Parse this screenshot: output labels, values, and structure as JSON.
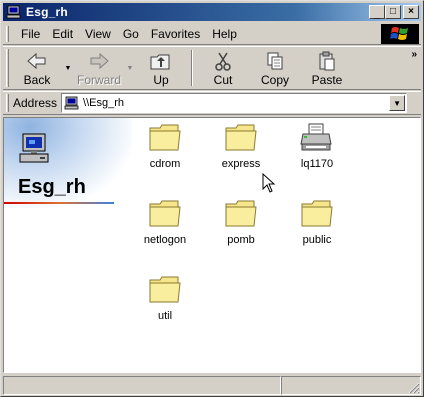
{
  "window": {
    "title": "Esg_rh",
    "controls": {
      "minimize": "_",
      "maximize": "□",
      "close": "×"
    }
  },
  "menu": [
    {
      "label": "File"
    },
    {
      "label": "Edit"
    },
    {
      "label": "View"
    },
    {
      "label": "Go"
    },
    {
      "label": "Favorites"
    },
    {
      "label": "Help"
    }
  ],
  "toolbar": {
    "back": {
      "label": "Back",
      "icon": "back-arrow-icon",
      "enabled": true
    },
    "forward": {
      "label": "Forward",
      "icon": "forward-arrow-icon",
      "enabled": false
    },
    "up": {
      "label": "Up",
      "icon": "up-folder-icon",
      "enabled": true
    },
    "cut": {
      "label": "Cut",
      "icon": "scissors-icon",
      "enabled": true
    },
    "copy": {
      "label": "Copy",
      "icon": "copy-icon",
      "enabled": true
    },
    "paste": {
      "label": "Paste",
      "icon": "paste-icon",
      "enabled": true
    },
    "more": "»"
  },
  "address": {
    "label": "Address",
    "value": "\\\\Esg_rh"
  },
  "left_panel": {
    "title": "Esg_rh",
    "icon": "network-computer-icon"
  },
  "items": [
    {
      "name": "cdrom",
      "type": "folder"
    },
    {
      "name": "express",
      "type": "folder"
    },
    {
      "name": "lq1170",
      "type": "printer"
    },
    {
      "name": "netlogon",
      "type": "folder"
    },
    {
      "name": "pomb",
      "type": "folder"
    },
    {
      "name": "public",
      "type": "folder"
    },
    {
      "name": "util",
      "type": "folder"
    }
  ],
  "colors": {
    "titlebar_start": "#0a246a",
    "titlebar_end": "#a6caf0",
    "chrome": "#d4d0c8",
    "folder": "#f5e68c"
  }
}
